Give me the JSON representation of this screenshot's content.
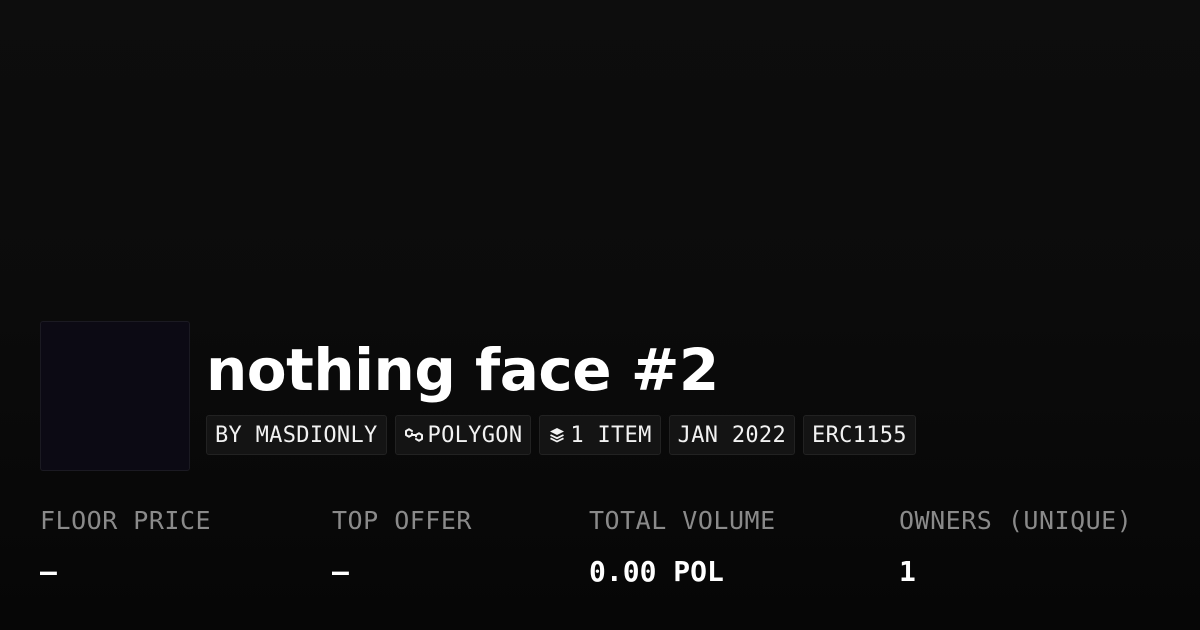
{
  "collection": {
    "title": "nothing face #2",
    "thumb_color": "#0c0a14"
  },
  "tags": {
    "creator": "BY MASDIONLY",
    "chain": "POLYGON",
    "chain_icon": "polygon-icon",
    "items": "1 ITEM",
    "items_icon": "layers-icon",
    "date": "JAN 2022",
    "standard": "ERC1155"
  },
  "stats": {
    "floor_price": {
      "label": "FLOOR PRICE",
      "value": "–"
    },
    "top_offer": {
      "label": "TOP OFFER",
      "value": "–"
    },
    "total_volume": {
      "label": "TOTAL VOLUME",
      "value": "0.00 POL"
    },
    "owners": {
      "label": "OWNERS (UNIQUE)",
      "value": "1"
    }
  },
  "colors": {
    "background": "#0b0b0b",
    "text": "#ffffff",
    "muted": "#8a8a8a",
    "tag_bg": "#141414"
  }
}
